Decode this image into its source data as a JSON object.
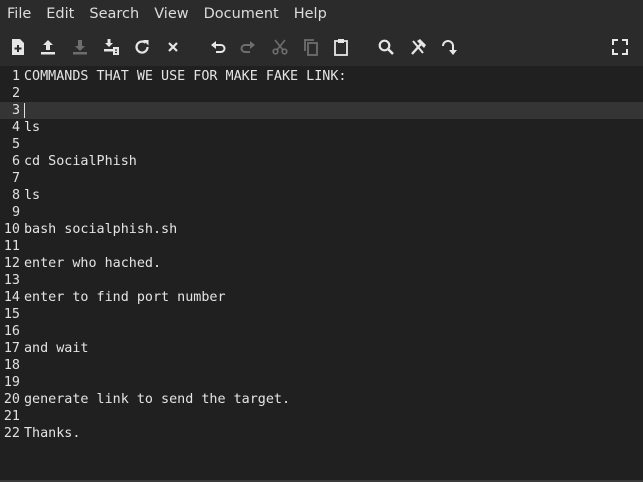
{
  "menu": [
    "File",
    "Edit",
    "Search",
    "View",
    "Document",
    "Help"
  ],
  "toolbar": [
    {
      "icon": "new-file-icon",
      "enabled": true
    },
    {
      "icon": "open-file-icon",
      "enabled": true
    },
    {
      "icon": "save-file-icon",
      "enabled": false
    },
    {
      "icon": "save-as-icon",
      "enabled": true
    },
    {
      "icon": "reload-icon",
      "enabled": true
    },
    {
      "icon": "close-icon",
      "enabled": true
    },
    {
      "icon": "undo-icon",
      "enabled": true
    },
    {
      "icon": "redo-icon",
      "enabled": false
    },
    {
      "icon": "cut-icon",
      "enabled": false
    },
    {
      "icon": "copy-icon",
      "enabled": false
    },
    {
      "icon": "paste-icon",
      "enabled": true
    },
    {
      "icon": "search-icon",
      "enabled": true
    },
    {
      "icon": "search-replace-icon",
      "enabled": true
    },
    {
      "icon": "goto-line-icon",
      "enabled": true
    },
    {
      "icon": "fullscreen-icon",
      "enabled": true
    }
  ],
  "editor": {
    "current_line": 3,
    "lines": [
      "COMMANDS THAT WE USE FOR MAKE FAKE LINK:",
      "",
      "",
      "ls",
      "",
      "cd SocialPhish",
      "",
      "ls",
      "",
      "bash socialphish.sh",
      "",
      "enter who hached.",
      "",
      "enter to find port number",
      "",
      "",
      "and wait",
      "",
      "",
      "generate link to send the target.",
      "",
      "Thanks."
    ]
  }
}
